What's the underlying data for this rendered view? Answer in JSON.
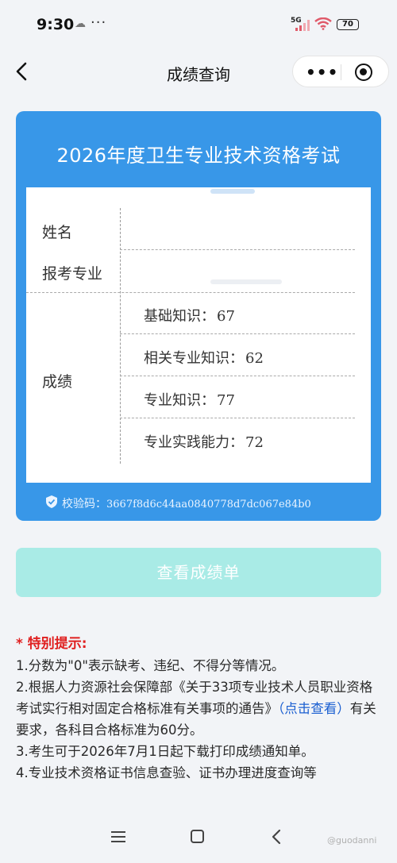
{
  "status_bar": {
    "time": "9:30",
    "network": "5G",
    "battery": "70",
    "notification_icons": [
      "cloud-icon",
      "more-dots-icon"
    ]
  },
  "navbar": {
    "title": "成绩查询",
    "back_icon": "chevron-left-icon",
    "more_icon": "more-dots-icon",
    "close_icon": "target-icon"
  },
  "card": {
    "title": "2026年度卫生专业技术资格考试",
    "rows": {
      "name_label": "姓名",
      "major_label": "报考专业",
      "score_label": "成绩"
    },
    "scores": [
      {
        "subject": "基础知识",
        "colon": "：",
        "value": "67"
      },
      {
        "subject": "相关专业知识",
        "colon": "：",
        "value": "62"
      },
      {
        "subject": "专业知识",
        "colon": "：",
        "value": "77"
      },
      {
        "subject": "专业实践能力",
        "colon": "：",
        "value": "72"
      }
    ],
    "check_label": "校验码：",
    "check_code": "3667f8d6c44aa0840778d7dc067e84b0",
    "colors": {
      "card": "#3897e8",
      "button": "#a9ebe6"
    }
  },
  "view_button": {
    "label": "查看成绩单"
  },
  "notes": {
    "title": "* 特别提示:",
    "items": [
      "1.分数为\"0\"表示缺考、违纪、不得分等情况。",
      "2.根据人力资源社会保障部《关于33项专业技术人员职业资格考试实行相对固定合格标准有关事项的通告》",
      "点击查看",
      "有关要求，各科目合格标准为60分。",
      "3.考生可于2026年7月1日起下载打印成绩通知单。",
      "4.专业技术资格证书信息查验、证书办理进度查询等"
    ]
  },
  "bottom_nav": {
    "icons": [
      "menu-icon",
      "home-icon",
      "back-icon"
    ]
  },
  "watermark": "@guodanni"
}
